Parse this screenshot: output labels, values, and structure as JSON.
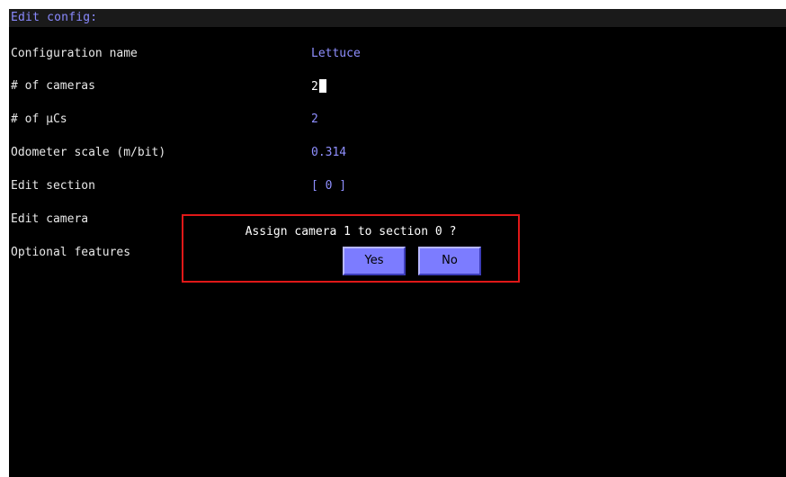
{
  "header": {
    "title": "Edit config:"
  },
  "fields": [
    {
      "label": "Configuration name",
      "value": "Lettuce"
    },
    {
      "label": "# of cameras",
      "value": "2"
    },
    {
      "label": "# of µCs",
      "value": "2"
    },
    {
      "label": "Odometer scale (m/bit)",
      "value": "0.314"
    },
    {
      "label": "Edit section",
      "value": "[ 0 ]"
    },
    {
      "label": "Edit camera",
      "value": ""
    },
    {
      "label": "Optional features",
      "value": ""
    }
  ],
  "dialog": {
    "message": "Assign camera 1 to section 0 ?",
    "yes_label": "Yes",
    "no_label": "No",
    "border_color": "#e01818"
  },
  "colors": {
    "background": "#000000",
    "label_text": "#e8e8e8",
    "value_text": "#8f8fff",
    "button_face": "#7c7cff"
  }
}
